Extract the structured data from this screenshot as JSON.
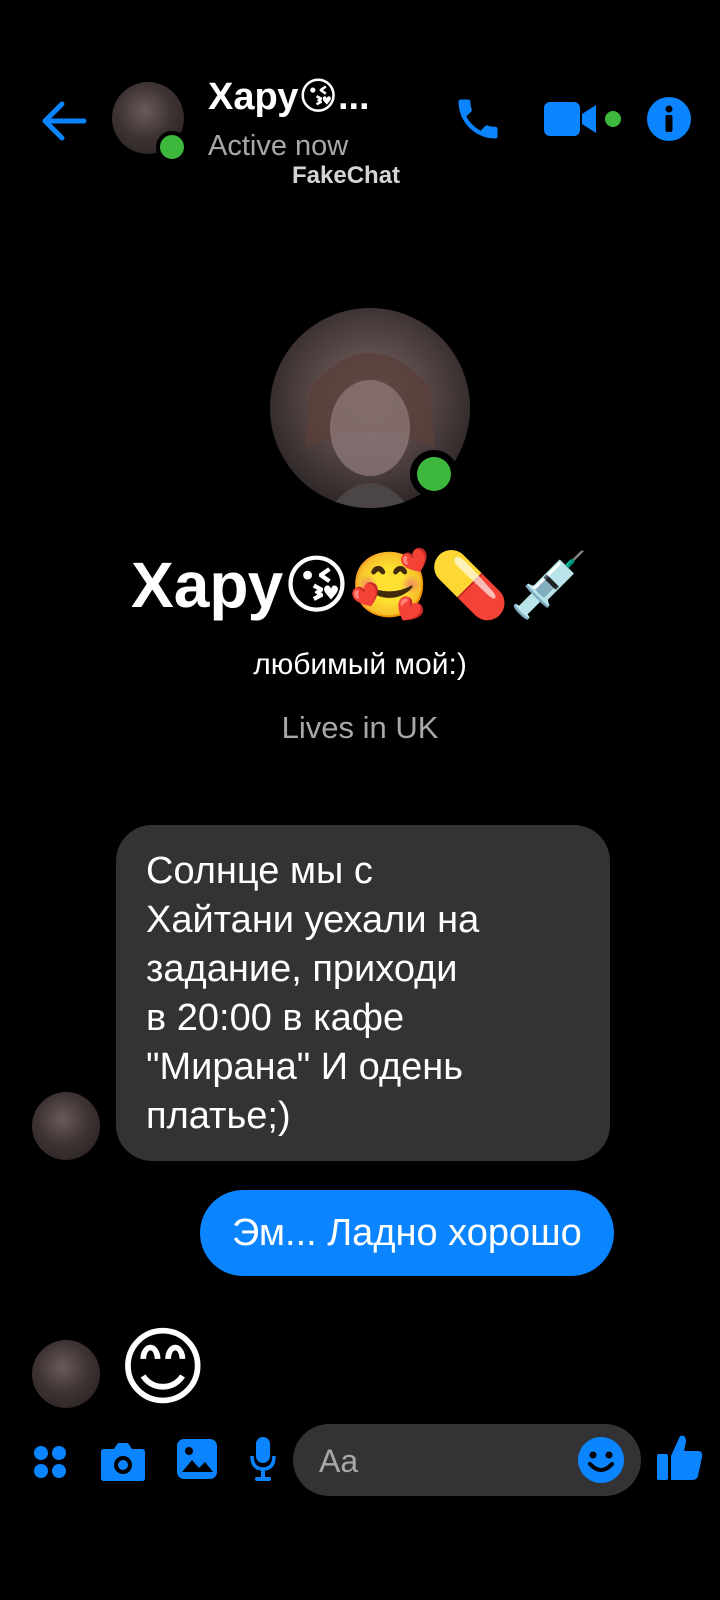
{
  "header": {
    "contact_name": "Хару😘...",
    "status": "Active now",
    "watermark": "FakeChat"
  },
  "profile": {
    "name": "Хару😘🥰💊💉",
    "bio": "любимый мой:)",
    "location": "Lives in UK"
  },
  "messages": [
    {
      "sender": "contact",
      "text": "Солнце мы с\nХайтани уехали на\nзадание, приходи\nв 20:00 в кафе\n\"Мирана\" И одень\nплатье;)"
    },
    {
      "sender": "me",
      "text": "Эм... Ладно хорошо"
    },
    {
      "sender": "contact",
      "text": "😊"
    }
  ],
  "composer": {
    "placeholder": "Aa"
  },
  "icons": {
    "back": "back-arrow-icon",
    "call": "phone-icon",
    "video": "video-camera-icon",
    "info": "info-icon",
    "menu": "grid-menu-icon",
    "camera": "camera-icon",
    "gallery": "image-icon",
    "mic": "microphone-icon",
    "emoji": "emoji-icon",
    "like": "thumbs-up-icon"
  },
  "colors": {
    "accent": "#0a84ff",
    "online": "#3db83d",
    "incoming_bubble": "#333235",
    "background": "#000000"
  }
}
